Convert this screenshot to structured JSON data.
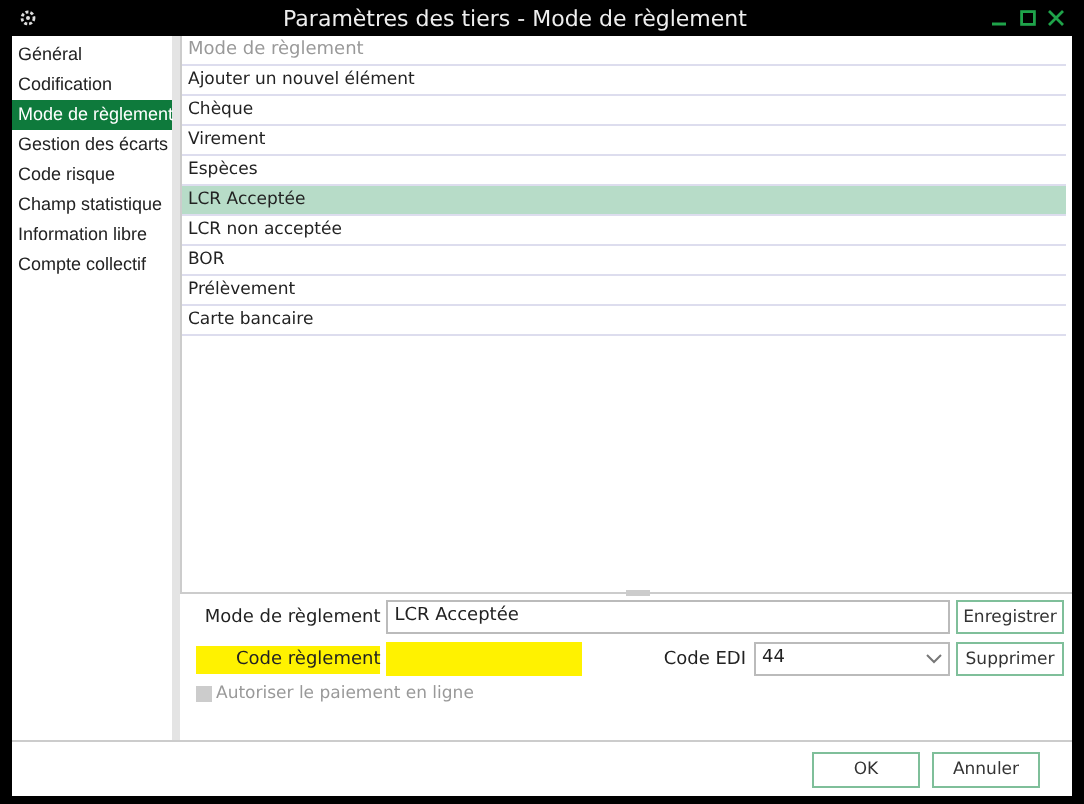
{
  "window": {
    "title": "Paramètres des tiers - Mode de règlement"
  },
  "sidebar": {
    "items": [
      {
        "label": "Général",
        "selected": false
      },
      {
        "label": "Codification",
        "selected": false
      },
      {
        "label": "Mode de règlement",
        "selected": true
      },
      {
        "label": "Gestion des écarts",
        "selected": false
      },
      {
        "label": "Code risque",
        "selected": false
      },
      {
        "label": "Champ statistique",
        "selected": false
      },
      {
        "label": "Information libre",
        "selected": false
      },
      {
        "label": "Compte collectif",
        "selected": false
      }
    ]
  },
  "list": {
    "header": "Mode de règlement",
    "rows": [
      {
        "label": "Ajouter un nouvel élément",
        "selected": false
      },
      {
        "label": "Chèque",
        "selected": false
      },
      {
        "label": "Virement",
        "selected": false
      },
      {
        "label": "Espèces",
        "selected": false
      },
      {
        "label": "LCR Acceptée",
        "selected": true
      },
      {
        "label": "LCR non acceptée",
        "selected": false
      },
      {
        "label": "BOR",
        "selected": false
      },
      {
        "label": "Prélèvement",
        "selected": false
      },
      {
        "label": "Carte bancaire",
        "selected": false
      }
    ]
  },
  "form": {
    "mode": {
      "label": "Mode de règlement",
      "value": "LCR Acceptée"
    },
    "code": {
      "label": "Code règlement",
      "highlighted": true
    },
    "edi": {
      "label": "Code EDI",
      "value": "44"
    },
    "online": {
      "label": "Autoriser le paiement en ligne",
      "checked": false,
      "disabled": true
    },
    "buttons": [
      "Enregistrer",
      "Supprimer"
    ]
  },
  "footer_buttons": [
    "OK",
    "Annuler"
  ]
}
